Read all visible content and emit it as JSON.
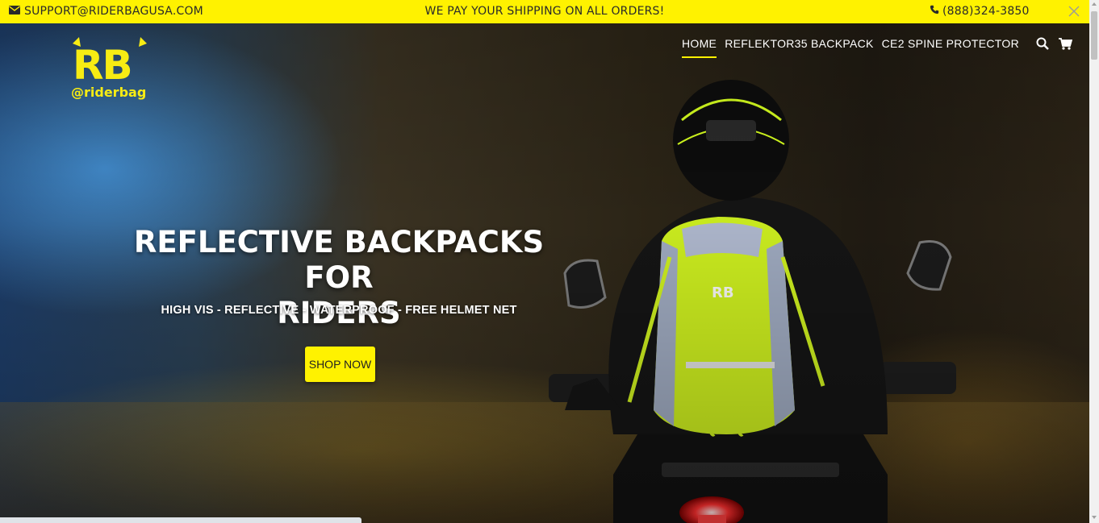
{
  "topbar": {
    "email": "SUPPORT@RIDERBAGUSA.COM",
    "promo": "WE PAY YOUR SHIPPING ON ALL ORDERS!",
    "phone": "(888)324-3850",
    "background_color": "#fff200"
  },
  "logo": {
    "letters": "RB",
    "handle": "@riderbag",
    "color": "#f7ec13"
  },
  "nav": {
    "items": [
      {
        "label": "HOME",
        "active": true
      },
      {
        "label": "REFLEKTOR35 BACKPACK",
        "active": false
      },
      {
        "label": "CE2 SPINE PROTECTOR",
        "active": false
      }
    ],
    "icons": [
      "search-icon",
      "cart-icon"
    ]
  },
  "hero": {
    "headline_line1": "REFLECTIVE BACKPACKS FOR",
    "headline_line2": "RIDERS",
    "subline": "HIGH VIS - REFLECTIVE - WATERPROOF - FREE HELMET NET",
    "cta_label": "SHOP NOW",
    "accent_color": "#fff200"
  }
}
